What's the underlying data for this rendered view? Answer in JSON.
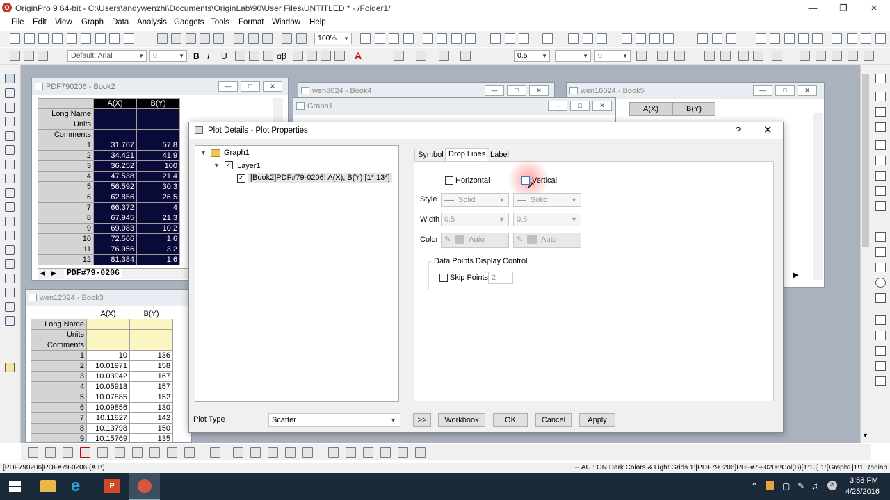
{
  "titlebar": {
    "text": "OriginPro 9 64-bit - C:\\Users\\andywenzhi\\Documents\\OriginLab\\90\\User Files\\UNTITLED * - /Folder1/",
    "app_icon": "origin-icon"
  },
  "menu": [
    "File",
    "Edit",
    "View",
    "Graph",
    "Data",
    "Analysis",
    "Gadgets",
    "Tools",
    "Format",
    "Window",
    "Help"
  ],
  "toolbar": {
    "zoom": "100%",
    "font": "Default: Arial",
    "font_size": "0",
    "line_width": "0.5",
    "fill_value": "0"
  },
  "book2": {
    "title": "PDF790206 - Book2",
    "col_a": "A(X)",
    "col_b": "B(Y)",
    "row_labels": [
      "Long Name",
      "Units",
      "Comments"
    ],
    "rows": [
      [
        "1",
        "31.767",
        "57.8"
      ],
      [
        "2",
        "34.421",
        "41.9"
      ],
      [
        "3",
        "36.252",
        "100"
      ],
      [
        "4",
        "47.538",
        "21.4"
      ],
      [
        "5",
        "56.592",
        "30.3"
      ],
      [
        "6",
        "62.856",
        "26.5"
      ],
      [
        "7",
        "66.372",
        "4"
      ],
      [
        "8",
        "67.945",
        "21.3"
      ],
      [
        "9",
        "69.083",
        "10.2"
      ],
      [
        "10",
        "72.566",
        "1.6"
      ],
      [
        "11",
        "76.956",
        "3.2"
      ],
      [
        "12",
        "81.384",
        "1.6"
      ]
    ],
    "sheet_tab": "PDF#79-0206"
  },
  "book3": {
    "title": "wen12024 - Book3",
    "col_a": "A(X)",
    "col_b": "B(Y)",
    "row_labels": [
      "Long Name",
      "Units",
      "Comments"
    ],
    "rows": [
      [
        "1",
        "10",
        "136"
      ],
      [
        "2",
        "10.01971",
        "158"
      ],
      [
        "3",
        "10.03942",
        "167"
      ],
      [
        "4",
        "10.05913",
        "157"
      ],
      [
        "5",
        "10.07885",
        "152"
      ],
      [
        "6",
        "10.09856",
        "130"
      ],
      [
        "7",
        "10.11827",
        "142"
      ],
      [
        "8",
        "10.13798",
        "150"
      ],
      [
        "9",
        "10.15769",
        "135"
      ]
    ]
  },
  "book4": {
    "title": "wen8024 - Book4"
  },
  "book5": {
    "title": "wen16024 - Book5",
    "col_a": "A(X)",
    "col_b": "B(Y)"
  },
  "graph1": {
    "title": "Graph1"
  },
  "dialog": {
    "title": "Plot Details - Plot Properties",
    "help": "?",
    "tree": {
      "graph": "Graph1",
      "layer": "Layer1",
      "plot": "[Book2]PDF#79-0206! A(X), B(Y) [1*:13*]"
    },
    "tabs": [
      "Symbol",
      "Drop Lines",
      "Label"
    ],
    "active_tab": "Drop Lines",
    "horizontal_label": "Horizontal",
    "vertical_label": "Vertical",
    "style_label": "Style",
    "width_label": "Width",
    "color_label": "Color",
    "style_h": "Solid",
    "style_v": "Solid",
    "width_h": "0.5",
    "width_v": "0.5",
    "color_h": "Auto",
    "color_v": "Auto",
    "group_title": "Data Points Display Control",
    "skip_label": "Skip Points",
    "skip_value": "2",
    "plot_type_label": "Plot Type",
    "plot_type": "Scatter",
    "buttons": {
      "expand": ">>",
      "workbook": "Workbook",
      "ok": "OK",
      "cancel": "Cancel",
      "apply": "Apply"
    }
  },
  "status": {
    "left": "[PDF790206]PDF#79-0206!(A,B)",
    "right": "-- AU : ON  Dark Colors & Light Grids  1:[PDF790206]PDF#79-0206!Col(B)[1:13]  1:[Graph1]1!1  Radian"
  },
  "taskbar": {
    "time": "3:58 PM",
    "date": "4/25/2016"
  }
}
